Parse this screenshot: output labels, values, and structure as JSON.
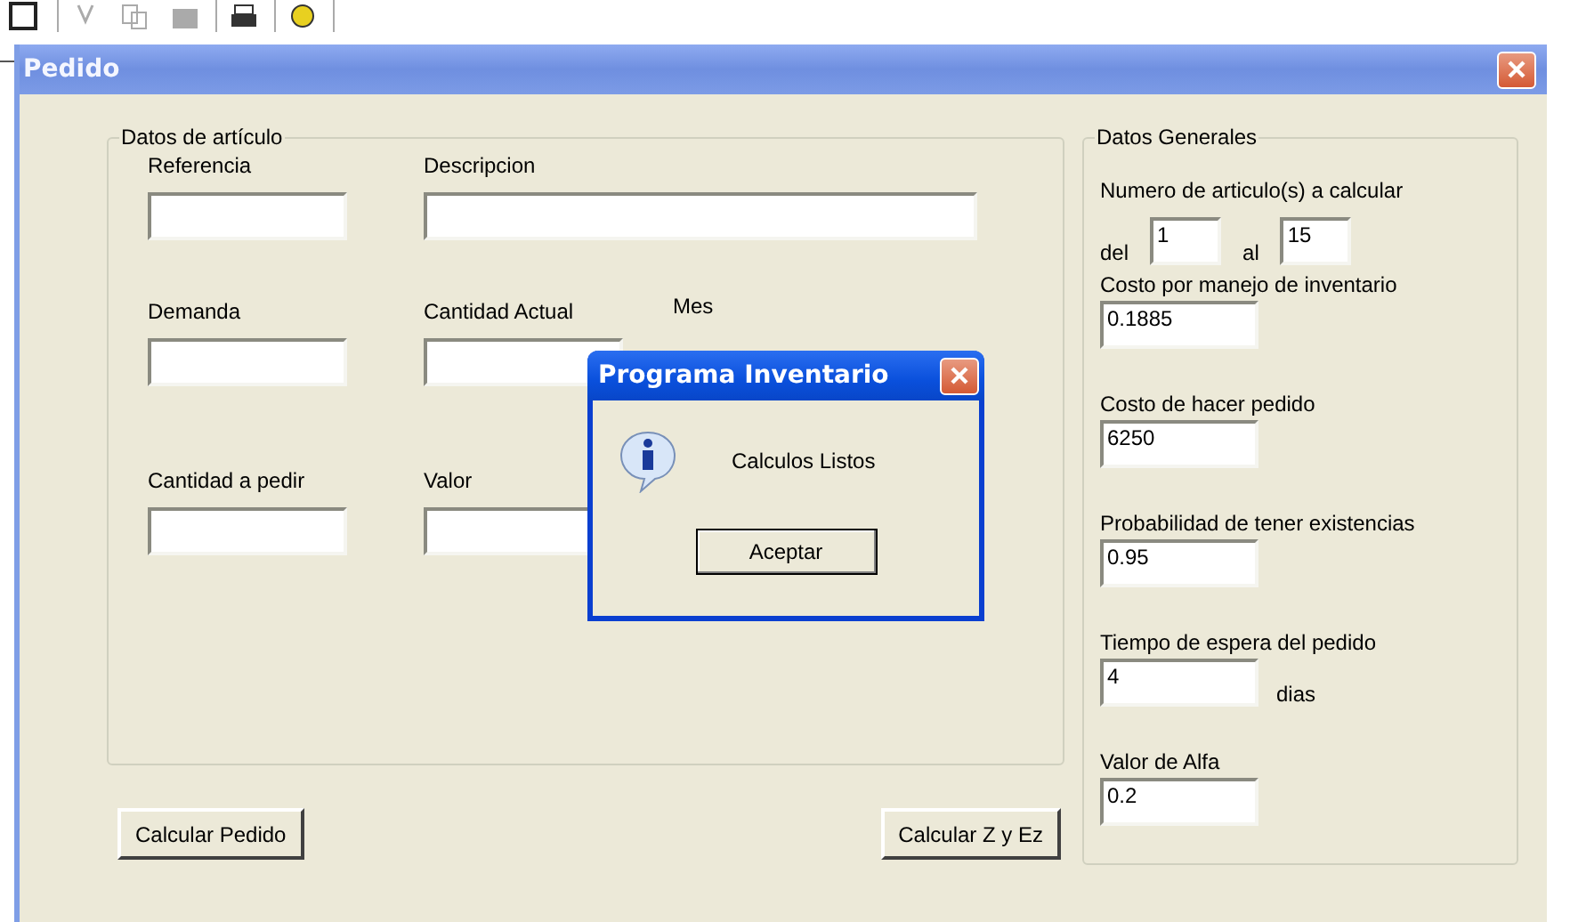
{
  "window": {
    "title": "Pedido"
  },
  "article_group": {
    "title": "Datos de artículo",
    "rows": [
      {
        "fields": [
          {
            "label": "Referencia"
          },
          {
            "label": "Descripcion"
          }
        ]
      },
      {
        "fields": [
          {
            "label": "Demanda"
          },
          {
            "label": "Cantidad Actual"
          },
          {
            "label": "Mes",
            "kind": "label"
          }
        ]
      },
      {
        "fields": [
          {
            "label": "Cantidad a pedir"
          },
          {
            "label": "Valor"
          }
        ]
      }
    ]
  },
  "general_group": {
    "title": "Datos Generales",
    "items": [
      {
        "kind": "range",
        "label": "Numero de articulo(s) a calcular",
        "from_label": "del",
        "from_value": "1",
        "to_label": "al",
        "to_value": "15"
      },
      {
        "kind": "number",
        "label": "Costo por manejo de inventario",
        "value": "0.1885"
      },
      {
        "kind": "number",
        "label": "Costo de hacer pedido",
        "value": "6250"
      },
      {
        "kind": "number",
        "label": "Probabilidad de tener existencias",
        "value": "0.95"
      },
      {
        "kind": "number",
        "label": "Tiempo de espera del pedido",
        "value": "4",
        "unit": "dias"
      },
      {
        "kind": "number",
        "label": "Valor de Alfa",
        "value": "0.2"
      }
    ]
  },
  "buttons": [
    "Calcular Pedido",
    "Calcular Z y Ez"
  ],
  "dialog": {
    "title": "Programa Inventario",
    "message": "Calculos Listos",
    "button": "Aceptar"
  }
}
